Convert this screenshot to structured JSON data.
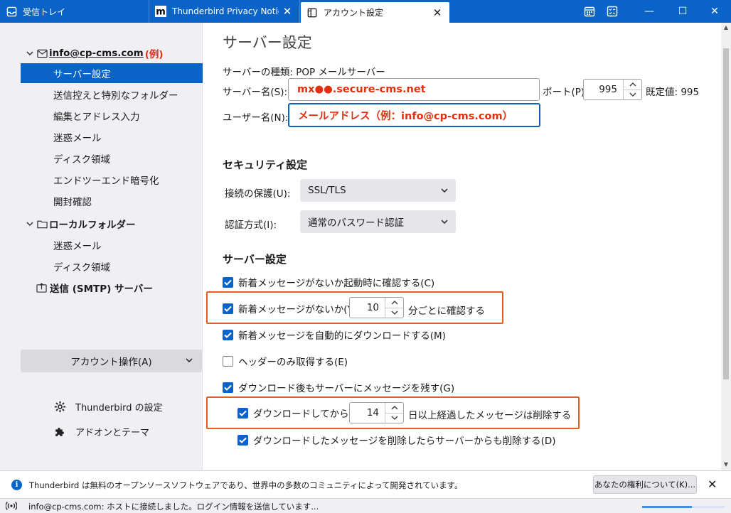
{
  "tabs": [
    {
      "label": "受信トレイ",
      "icon": "inbox-icon"
    },
    {
      "label": "Thunderbird Privacy Notice",
      "icon": "mozilla-m-icon",
      "close": "✕"
    },
    {
      "label": "アカウント設定",
      "icon": "settings-page-icon",
      "close": "✕"
    }
  ],
  "window_controls": {
    "minimize": "—",
    "maximize": "☐",
    "close": "✕"
  },
  "sidebar": {
    "account_name": "info@cp-cms.com",
    "account_note": "(例)",
    "account_items": [
      "サーバー設定",
      "送信控えと特別なフォルダー",
      "編集とアドレス入力",
      "迷惑メール",
      "ディスク領域",
      "エンドツーエンド暗号化",
      "開封確認"
    ],
    "local_folders": "ローカルフォルダー",
    "local_items": [
      "迷惑メール",
      "ディスク領域"
    ],
    "smtp": "送信 (SMTP) サーバー",
    "account_ops": "アカウント操作(A)",
    "settings_link": "Thunderbird の設定",
    "addons_link": "アドオンとテーマ"
  },
  "main": {
    "title": "サーバー設定",
    "server_type": "サーバーの種類: POP メールサーバー",
    "server_name_label": "サーバー名(S):",
    "server_name_value": "mx●●.secure-cms.net",
    "port_label": "ポート(P):",
    "port_value": "995",
    "default_label": "既定値: 995",
    "username_label": "ユーザー名(N):",
    "username_value": "メールアドレス（例：info@cp-cms.com）",
    "security_heading": "セキュリティ設定",
    "connection_label": "接続の保護(U):",
    "connection_value": "SSL/TLS",
    "auth_label": "認証方式(I):",
    "auth_value": "通常のパスワード認証",
    "server_heading": "サーバー設定",
    "options": {
      "check_startup": {
        "label": "新着メッセージがないか起動時に確認する(C)",
        "checked": true
      },
      "check_every": {
        "label": "新着メッセージがないか(Y)",
        "checked": true,
        "value": "10",
        "suffix": "分ごとに確認する"
      },
      "auto_download": {
        "label": "新着メッセージを自動的にダウンロードする(M)",
        "checked": true
      },
      "headers_only": {
        "label": "ヘッダーのみ取得する(E)",
        "checked": false
      },
      "leave_on_server": {
        "label": "ダウンロード後もサーバーにメッセージを残す(G)",
        "checked": true
      },
      "delete_after": {
        "label": "ダウンロードしてから(O)",
        "checked": true,
        "value": "14",
        "suffix": "日以上経過したメッセージは削除する"
      },
      "delete_when_deleted": {
        "label": "ダウンロードしたメッセージを削除したらサーバーからも削除する(D)",
        "checked": true
      }
    }
  },
  "notification": {
    "text": "Thunderbird は無料のオープンソースソフトウェアであり、世界中の多数のコミュニティによって開発されています。",
    "button": "あなたの権利について(K)...",
    "close": "✕"
  },
  "status": {
    "text": "info@cp-cms.com: ホストに接続しました。ログイン情報を送信しています...",
    "progress": 0.6
  },
  "colors": {
    "accent": "#0a64c8",
    "highlight_border": "#e06020",
    "annotation_text": "#e03010"
  }
}
